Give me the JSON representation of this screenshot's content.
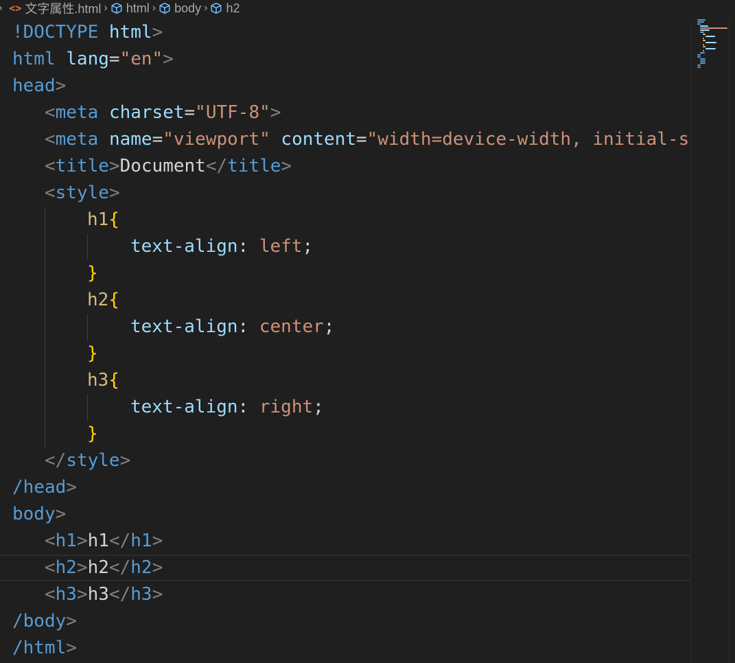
{
  "breadcrumb": {
    "file": "文字属性.html",
    "items": [
      "html",
      "body",
      "h2"
    ]
  },
  "colors": {
    "background": "#1f1f1f",
    "tag": "#569cd6",
    "punctuation": "#808080",
    "attribute": "#9cdcfe",
    "string": "#ce9178",
    "selector": "#d7ba7d",
    "brace": "#ffd700",
    "file_icon": "#e37933"
  },
  "code": {
    "l1_doctype": "!DOCTYPE",
    "l1_html": "html",
    "l2_html": "html",
    "l2_attr": "lang",
    "l2_val": "\"en\"",
    "l3_head": "head",
    "l4_meta": "meta",
    "l4_attr": "charset",
    "l4_val": "\"UTF-8\"",
    "l5_meta": "meta",
    "l5_attr1": "name",
    "l5_val1": "\"viewport\"",
    "l5_attr2": "content",
    "l5_val2": "\"width=device-width, initial-s",
    "l6_title": "title",
    "l6_text": "Document",
    "l7_style": "style",
    "l8_sel": "h1",
    "l9_prop": "text-align",
    "l9_val": "left",
    "l11_sel": "h2",
    "l12_prop": "text-align",
    "l12_val": "center",
    "l14_sel": "h3",
    "l15_prop": "text-align",
    "l15_val": "right",
    "l17_style": "style",
    "l18_head": "head",
    "l19_body": "body",
    "l20_tag": "h1",
    "l20_text": "h1",
    "l21_tag": "h2",
    "l21_text": "h2",
    "l22_tag": "h3",
    "l22_text": "h3",
    "l23_body": "body",
    "l24_html": "html"
  }
}
